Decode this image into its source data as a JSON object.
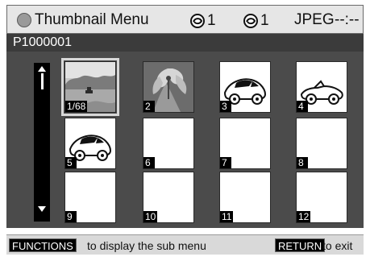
{
  "app": {
    "title": "Thumbnail Menu",
    "status": {
      "shots_1": "1",
      "shots_2": "1",
      "format": "JPEG",
      "time": "--:--"
    },
    "filename": "P1000001"
  },
  "thumbnails": [
    {
      "label": "1/68",
      "content": "harbor-photo",
      "selected": true
    },
    {
      "label": "2",
      "content": "flower-photo"
    },
    {
      "label": "3",
      "content": "car-icon"
    },
    {
      "label": "4",
      "content": "convertible-icon"
    },
    {
      "label": "5",
      "content": "car-icon"
    },
    {
      "label": "6",
      "content": "blank"
    },
    {
      "label": "7",
      "content": "blank"
    },
    {
      "label": "8",
      "content": "blank"
    },
    {
      "label": "9",
      "content": "blank"
    },
    {
      "label": "10",
      "content": "blank"
    },
    {
      "label": "11",
      "content": "blank"
    },
    {
      "label": "12",
      "content": "blank"
    }
  ],
  "footer": {
    "functions_key": "FUNCTIONS",
    "functions_hint": "to display the sub menu",
    "return_key": "RETURN",
    "return_hint": "to exit"
  },
  "colors": {
    "panel": "#4b4b4b",
    "namebar": "#3b3b3b",
    "topbar": "#e6e6e6",
    "footer": "#d9d9d9"
  }
}
